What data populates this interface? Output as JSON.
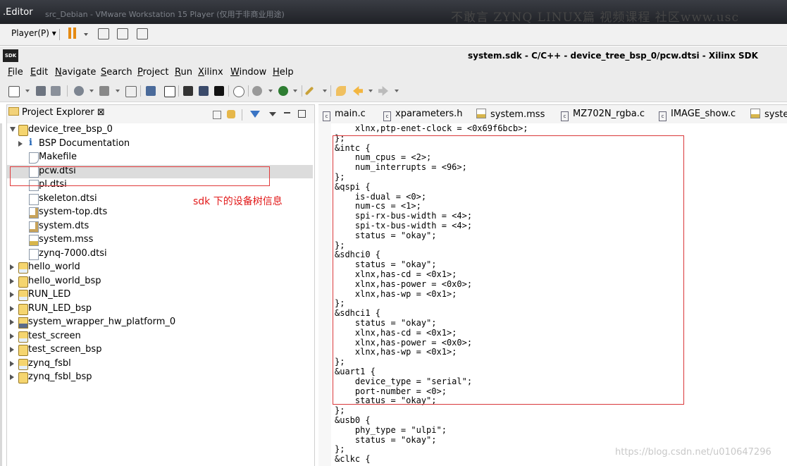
{
  "vmware": {
    "window_label": ".Editor",
    "title_ghost": "src_Debian - VMware Workstation 15 Player (仅用于非商业用途)",
    "watermark": "不敢言 ZYNQ LINUX篇 视频课程 社区www.usc",
    "player_menu": "Player(P) ▾"
  },
  "sdk": {
    "logo_text": "SDK",
    "window_title": "system.sdk - C/C++ - device_tree_bsp_0/pcw.dtsi - Xilinx SDK"
  },
  "menubar": [
    "File",
    "Edit",
    "Navigate",
    "Search",
    "Project",
    "Run",
    "Xilinx",
    "Window",
    "Help"
  ],
  "explorer": {
    "tab_label": "Project Explorer ⊠",
    "items": [
      {
        "label": "device_tree_bsp_0",
        "icon": "bsp-project-icon",
        "expander": "open",
        "indent": 0
      },
      {
        "label": "BSP Documentation",
        "icon": "info-icon",
        "expander": "closed",
        "indent": 1
      },
      {
        "label": "Makefile",
        "icon": "makefile-icon",
        "expander": "",
        "indent": 1
      },
      {
        "label": "pcw.dtsi",
        "icon": "file-icon",
        "expander": "",
        "indent": 1
      },
      {
        "label": "pl.dtsi",
        "icon": "file-icon",
        "expander": "",
        "indent": 1
      },
      {
        "label": "skeleton.dtsi",
        "icon": "file-icon",
        "expander": "",
        "indent": 1
      },
      {
        "label": "system-top.dts",
        "icon": "dts-icon",
        "expander": "",
        "indent": 1
      },
      {
        "label": "system.dts",
        "icon": "dts-icon",
        "expander": "",
        "indent": 1
      },
      {
        "label": "system.mss",
        "icon": "mss-icon",
        "expander": "",
        "indent": 1
      },
      {
        "label": "zynq-7000.dtsi",
        "icon": "file-icon",
        "expander": "",
        "indent": 1
      },
      {
        "label": "hello_world",
        "icon": "c-project-icon",
        "expander": "closed",
        "indent": 0
      },
      {
        "label": "hello_world_bsp",
        "icon": "bsp-project-icon",
        "expander": "closed",
        "indent": 0
      },
      {
        "label": "RUN_LED",
        "icon": "c-project-icon",
        "expander": "closed",
        "indent": 0
      },
      {
        "label": "RUN_LED_bsp",
        "icon": "bsp-project-icon",
        "expander": "closed",
        "indent": 0
      },
      {
        "label": "system_wrapper_hw_platform_0",
        "icon": "hw-platform-icon",
        "expander": "closed",
        "indent": 0
      },
      {
        "label": "test_screen",
        "icon": "c-project-icon",
        "expander": "closed",
        "indent": 0
      },
      {
        "label": "test_screen_bsp",
        "icon": "bsp-project-icon",
        "expander": "closed",
        "indent": 0
      },
      {
        "label": "zynq_fsbl",
        "icon": "c-project-icon",
        "expander": "closed",
        "indent": 0
      },
      {
        "label": "zynq_fsbl_bsp",
        "icon": "bsp-project-icon",
        "expander": "closed",
        "indent": 0
      }
    ],
    "selected_index": 3
  },
  "annotation": {
    "label": "sdk 下的设备树信息",
    "color": "#e21b1b"
  },
  "editor": {
    "tabs": [
      {
        "label": "main.c",
        "icon": "c-file-icon"
      },
      {
        "label": "xparameters.h",
        "icon": "h-file-icon"
      },
      {
        "label": "system.mss",
        "icon": "mss-icon"
      },
      {
        "label": "MZ702N_rgba.c",
        "icon": "c-file-icon"
      },
      {
        "label": "IMAGE_show.c",
        "icon": "c-file-icon"
      },
      {
        "label": "syster",
        "icon": "mss-icon"
      }
    ],
    "code_lines": [
      "    xlnx,ptp-enet-clock = <0x69f6bcb>;",
      "};",
      "&intc {",
      "    num_cpus = <2>;",
      "    num_interrupts = <96>;",
      "};",
      "&qspi {",
      "    is-dual = <0>;",
      "    num-cs = <1>;",
      "    spi-rx-bus-width = <4>;",
      "    spi-tx-bus-width = <4>;",
      "    status = \"okay\";",
      "};",
      "&sdhci0 {",
      "    status = \"okay\";",
      "    xlnx,has-cd = <0x1>;",
      "    xlnx,has-power = <0x0>;",
      "    xlnx,has-wp = <0x1>;",
      "};",
      "&sdhci1 {",
      "    status = \"okay\";",
      "    xlnx,has-cd = <0x1>;",
      "    xlnx,has-power = <0x0>;",
      "    xlnx,has-wp = <0x1>;",
      "};",
      "&uart1 {",
      "    device_type = \"serial\";",
      "    port-number = <0>;",
      "    status = \"okay\";",
      "};",
      "&usb0 {",
      "    phy_type = \"ulpi\";",
      "    status = \"okay\";",
      "};",
      "&clkc {"
    ]
  },
  "csdn_watermark": "https://blog.csdn.net/u010647296"
}
